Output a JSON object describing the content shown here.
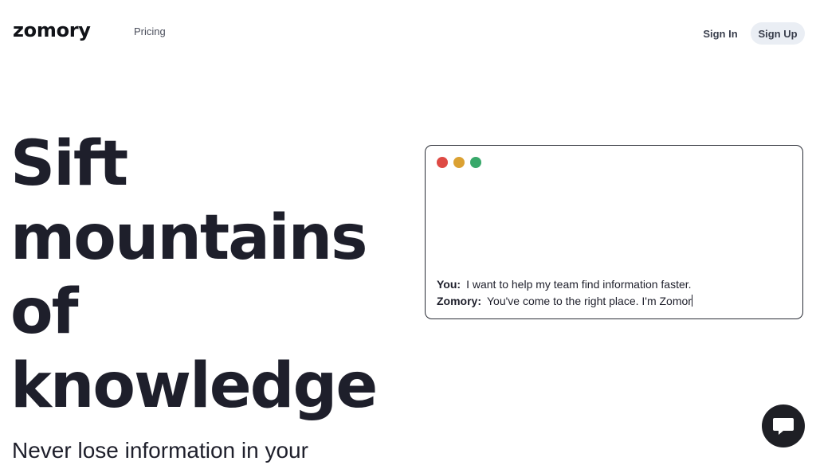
{
  "header": {
    "logo_text": "zomory",
    "nav": [
      {
        "label": "Pricing"
      }
    ],
    "sign_in_label": "Sign In",
    "sign_up_label": "Sign Up"
  },
  "hero": {
    "title_lines": [
      "Sift",
      "mountains",
      "of",
      "knowledge"
    ],
    "subtitle": "Never lose information in your"
  },
  "chat_window": {
    "dots": [
      {
        "name": "close",
        "color": "#de4a44"
      },
      {
        "name": "minimize",
        "color": "#dba132"
      },
      {
        "name": "maximize",
        "color": "#38a86a"
      }
    ],
    "messages": [
      {
        "speaker": "You:",
        "text": "I want to help my team find information faster."
      },
      {
        "speaker": "Zomory:",
        "text": "You've come to the right place. I'm Zomor"
      }
    ]
  },
  "chat_widget": {
    "icon": "chat-bubble-icon",
    "color": "#1e1f25"
  },
  "colors": {
    "text": "#1e1f2b",
    "sign_up_bg": "#eaeef4"
  }
}
